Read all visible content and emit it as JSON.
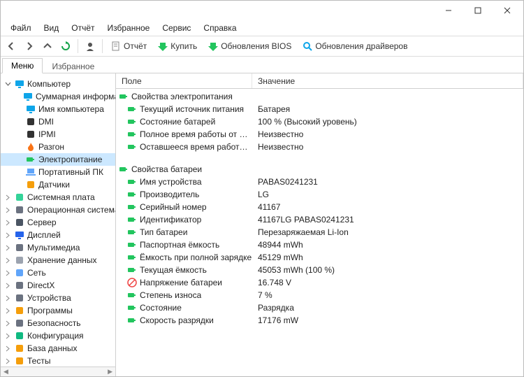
{
  "menu": {
    "file": "Файл",
    "view": "Вид",
    "report": "Отчёт",
    "favorites": "Избранное",
    "service": "Сервис",
    "help": "Справка"
  },
  "toolbar": {
    "report": "Отчёт",
    "buy": "Купить",
    "bios": "Обновления BIOS",
    "drivers": "Обновления драйверов"
  },
  "tabs": {
    "menu": "Меню",
    "favorites": "Избранное"
  },
  "columns": {
    "field": "Поле",
    "value": "Значение"
  },
  "tree": [
    {
      "id": "computer",
      "label": "Компьютер",
      "icon": "monitor-icon",
      "indent": 0,
      "exp": "minus"
    },
    {
      "id": "summary",
      "label": "Суммарная информа…",
      "icon": "monitor-icon",
      "indent": 1
    },
    {
      "id": "compname",
      "label": "Имя компьютера",
      "icon": "monitor-icon",
      "indent": 1
    },
    {
      "id": "dmi",
      "label": "DMI",
      "icon": "chip-icon",
      "indent": 1
    },
    {
      "id": "ipmi",
      "label": "IPMI",
      "icon": "chip-icon",
      "indent": 1
    },
    {
      "id": "overclock",
      "label": "Разгон",
      "icon": "flame-icon",
      "indent": 1
    },
    {
      "id": "power",
      "label": "Электропитание",
      "icon": "battery-icon",
      "indent": 1,
      "selected": true
    },
    {
      "id": "portable",
      "label": "Портативный ПК",
      "icon": "laptop-icon",
      "indent": 1
    },
    {
      "id": "sensors",
      "label": "Датчики",
      "icon": "sensor-icon",
      "indent": 1
    },
    {
      "id": "mobo",
      "label": "Системная плата",
      "icon": "board-icon",
      "indent": 0,
      "exp": "plus"
    },
    {
      "id": "os",
      "label": "Операционная система",
      "icon": "os-icon",
      "indent": 0,
      "exp": "plus"
    },
    {
      "id": "server",
      "label": "Сервер",
      "icon": "server-icon",
      "indent": 0,
      "exp": "plus"
    },
    {
      "id": "display",
      "label": "Дисплей",
      "icon": "display-icon",
      "indent": 0,
      "exp": "plus"
    },
    {
      "id": "multimedia",
      "label": "Мультимедиа",
      "icon": "sound-icon",
      "indent": 0,
      "exp": "plus"
    },
    {
      "id": "storage",
      "label": "Хранение данных",
      "icon": "disk-icon",
      "indent": 0,
      "exp": "plus"
    },
    {
      "id": "network",
      "label": "Сеть",
      "icon": "net-icon",
      "indent": 0,
      "exp": "plus"
    },
    {
      "id": "directx",
      "label": "DirectX",
      "icon": "dx-icon",
      "indent": 0,
      "exp": "plus"
    },
    {
      "id": "devices",
      "label": "Устройства",
      "icon": "device-icon",
      "indent": 0,
      "exp": "plus"
    },
    {
      "id": "programs",
      "label": "Программы",
      "icon": "prog-icon",
      "indent": 0,
      "exp": "plus"
    },
    {
      "id": "security",
      "label": "Безопасность",
      "icon": "sec-icon",
      "indent": 0,
      "exp": "plus"
    },
    {
      "id": "config",
      "label": "Конфигурация",
      "icon": "cfg-icon",
      "indent": 0,
      "exp": "plus"
    },
    {
      "id": "database",
      "label": "База данных",
      "icon": "db-icon",
      "indent": 0,
      "exp": "plus"
    },
    {
      "id": "tests",
      "label": "Тесты",
      "icon": "test-icon",
      "indent": 0,
      "exp": "plus"
    }
  ],
  "content": [
    {
      "type": "group",
      "label": "Свойства электропитания"
    },
    {
      "type": "row",
      "field": "Текущий источник питания",
      "value": "Батарея",
      "icon": "battery-icon"
    },
    {
      "type": "row",
      "field": "Состояние батарей",
      "value": "100 % (Высокий уровень)",
      "icon": "battery-icon"
    },
    {
      "type": "row",
      "field": "Полное время работы от бата…",
      "value": "Неизвестно",
      "icon": "battery-icon"
    },
    {
      "type": "row",
      "field": "Оставшееся время работы от …",
      "value": "Неизвестно",
      "icon": "battery-icon"
    },
    {
      "type": "gap"
    },
    {
      "type": "group",
      "label": "Свойства батареи"
    },
    {
      "type": "row",
      "field": "Имя устройства",
      "value": "PABAS0241231",
      "icon": "battery-icon"
    },
    {
      "type": "row",
      "field": "Производитель",
      "value": "LG",
      "icon": "battery-icon"
    },
    {
      "type": "row",
      "field": "Серийный номер",
      "value": "41167",
      "icon": "battery-icon"
    },
    {
      "type": "row",
      "field": "Идентификатор",
      "value": "41167LG PABAS0241231",
      "icon": "battery-icon"
    },
    {
      "type": "row",
      "field": "Тип батареи",
      "value": "Перезаряжаемая Li-Ion",
      "icon": "battery-icon"
    },
    {
      "type": "row",
      "field": "Паспортная ёмкость",
      "value": "48944 mWh",
      "icon": "battery-icon"
    },
    {
      "type": "row",
      "field": "Ёмкость при полной зарядке",
      "value": "45129 mWh",
      "icon": "battery-icon"
    },
    {
      "type": "row",
      "field": "Текущая ёмкость",
      "value": "45053 mWh  (100 %)",
      "icon": "battery-icon"
    },
    {
      "type": "row",
      "field": "Напряжение батареи",
      "value": "16.748 V",
      "icon": "warn-icon"
    },
    {
      "type": "row",
      "field": "Степень износа",
      "value": "7 %",
      "icon": "battery-icon"
    },
    {
      "type": "row",
      "field": "Состояние",
      "value": "Разрядка",
      "icon": "battery-icon"
    },
    {
      "type": "row",
      "field": "Скорость разрядки",
      "value": "17176 mW",
      "icon": "battery-icon"
    }
  ],
  "icons": {
    "monitor-icon": "#0EA5E9",
    "chip-icon": "#333333",
    "flame-icon": "#F97316",
    "battery-icon": "#22C55E",
    "laptop-icon": "#60A5FA",
    "sensor-icon": "#F59E0B",
    "board-icon": "#34D399",
    "os-icon": "#6B7280",
    "server-icon": "#4B5563",
    "display-icon": "#2563EB",
    "sound-icon": "#6B7280",
    "disk-icon": "#9CA3AF",
    "net-icon": "#60A5FA",
    "dx-icon": "#6B7280",
    "device-icon": "#6B7280",
    "prog-icon": "#F59E0B",
    "sec-icon": "#6B7280",
    "cfg-icon": "#10B981",
    "db-icon": "#F59E0B",
    "test-icon": "#F59E0B",
    "warn-icon": "#EF4444"
  }
}
